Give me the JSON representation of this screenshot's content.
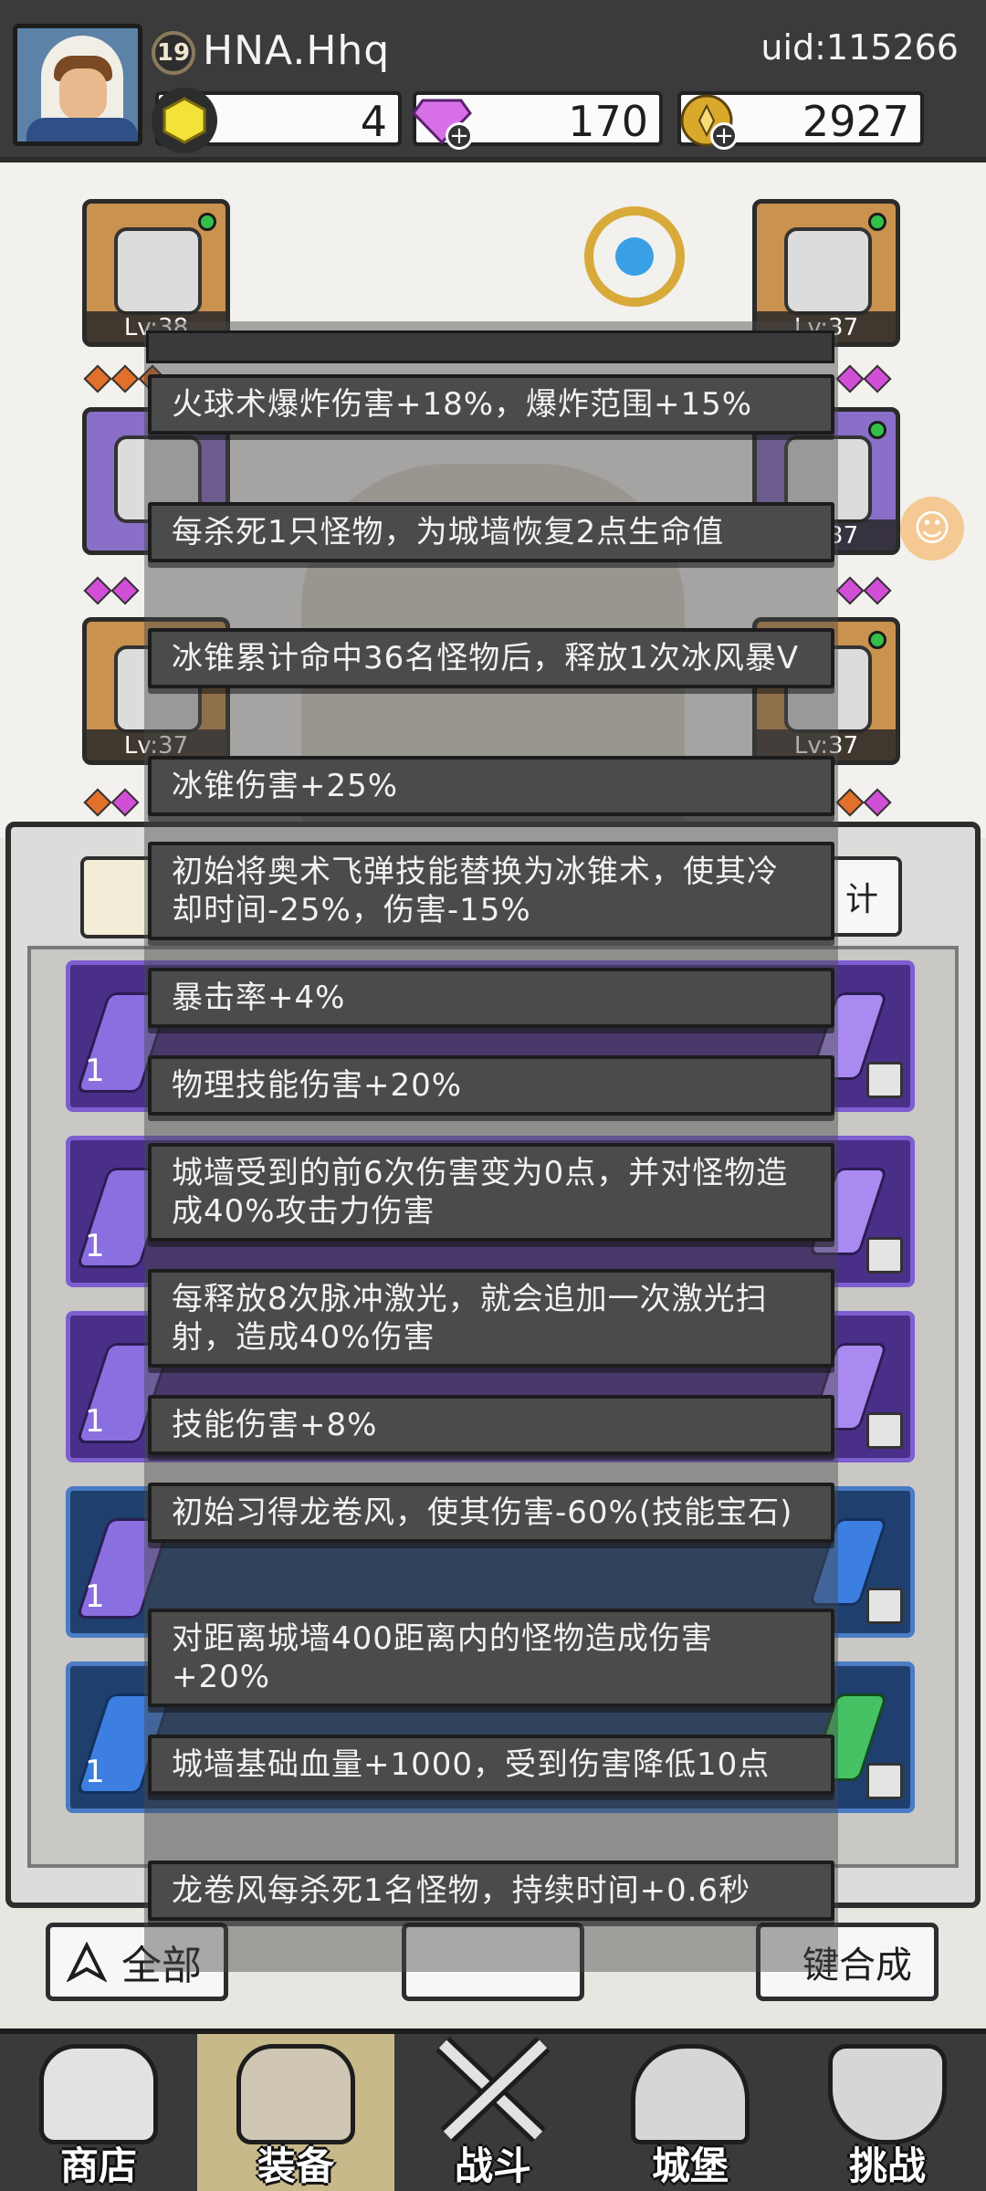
{
  "header": {
    "player_level": "19",
    "player_name": "HNA.Hhq",
    "uid": "uid:115266",
    "currencies": [
      {
        "name": "gold-gem",
        "value": "4",
        "color": "#f2d62a"
      },
      {
        "name": "diamond",
        "value": "170",
        "color": "#d770e6"
      },
      {
        "name": "coin",
        "value": "2927",
        "color": "#d9a92b"
      }
    ]
  },
  "equipment": {
    "slots": [
      {
        "level": "Lv:38"
      },
      {
        "level": "Lv:37"
      },
      {
        "level": "Lv:37"
      },
      {
        "level": "Lv:37"
      },
      {
        "level": "Lv:37"
      }
    ]
  },
  "bag": {
    "tab_right_label": "计",
    "row_counts": [
      "1",
      "1",
      "1",
      "1",
      "1"
    ]
  },
  "controls": {
    "filter_label": "全部",
    "combine_label": "键合成"
  },
  "effects": [
    "火球术爆炸伤害+18%，爆炸范围+15%",
    "每杀死1只怪物，为城墙恢复2点生命值",
    "冰锥累计命中36名怪物后，释放1次冰风暴V",
    "冰锥伤害+25%",
    "初始将奥术飞弹技能替换为冰锥术，使其冷却时间-25%，伤害-15%",
    "暴击率+4%",
    "物理技能伤害+20%",
    "城墙受到的前6次伤害变为0点，并对怪物造成40%攻击力伤害",
    "每释放8次脉冲激光，就会追加一次激光扫射，造成40%伤害",
    "技能伤害+8%",
    "初始习得龙卷风，使其伤害-60%(技能宝石)",
    "对距离城墙400距离内的怪物造成伤害+20%",
    "城墙基础血量+1000，受到伤害降低10点",
    "龙卷风每杀死1名怪物，持续时间+0.6秒"
  ],
  "nav": [
    {
      "label": "商店"
    },
    {
      "label": "装备"
    },
    {
      "label": "战斗"
    },
    {
      "label": "城堡"
    },
    {
      "label": "挑战"
    }
  ]
}
